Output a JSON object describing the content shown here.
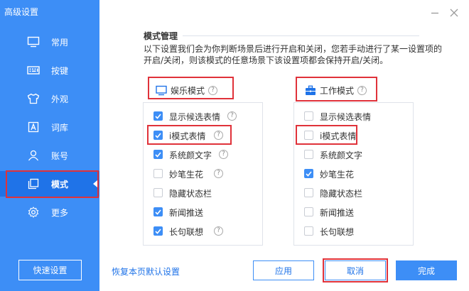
{
  "window": {
    "title": "高级设置"
  },
  "sidebar": {
    "items": [
      {
        "label": "常用",
        "icon": "monitor-icon"
      },
      {
        "label": "按键",
        "icon": "keyboard-icon"
      },
      {
        "label": "外观",
        "icon": "shirt-icon"
      },
      {
        "label": "词库",
        "icon": "dictionary-icon"
      },
      {
        "label": "账号",
        "icon": "user-icon"
      },
      {
        "label": "模式",
        "icon": "mode-icon",
        "active": true
      },
      {
        "label": "更多",
        "icon": "gear-icon"
      }
    ],
    "quick_button": "快速设置"
  },
  "main": {
    "section_title": "模式管理",
    "description": "以下设置我们会为你判断场景后进行开启和关闭，您若手动进行了某一设置项的开启/关闭，则该模式的任意场景下该设置项都会保持开启/关闭。",
    "entertainment": {
      "title": "娱乐模式",
      "options": [
        {
          "label": "显示候选表情",
          "checked": true,
          "help": true
        },
        {
          "label": "i模式表情",
          "checked": true,
          "help": true
        },
        {
          "label": "系统颜文字",
          "checked": true,
          "help": true
        },
        {
          "label": "妙笔生花",
          "checked": false,
          "help": true
        },
        {
          "label": "隐藏状态栏",
          "checked": false,
          "help": false
        },
        {
          "label": "新闻推送",
          "checked": true,
          "help": false
        },
        {
          "label": "长句联想",
          "checked": true,
          "help": true
        }
      ]
    },
    "work": {
      "title": "工作模式",
      "options": [
        {
          "label": "显示候选表情",
          "checked": false
        },
        {
          "label": "i模式表情",
          "checked": false
        },
        {
          "label": "系统颜文字",
          "checked": false
        },
        {
          "label": "妙笔生花",
          "checked": true
        },
        {
          "label": "隐藏状态栏",
          "checked": false
        },
        {
          "label": "新闻推送",
          "checked": false
        },
        {
          "label": "长句联想",
          "checked": false
        }
      ]
    }
  },
  "footer": {
    "restore_link": "恢复本页默认设置",
    "apply": "应用",
    "cancel": "取消",
    "done": "完成"
  },
  "help_mark": "?",
  "colors": {
    "accent": "#3d8ef6",
    "active_nav": "#1f73e8",
    "highlight": "#e0323a"
  }
}
